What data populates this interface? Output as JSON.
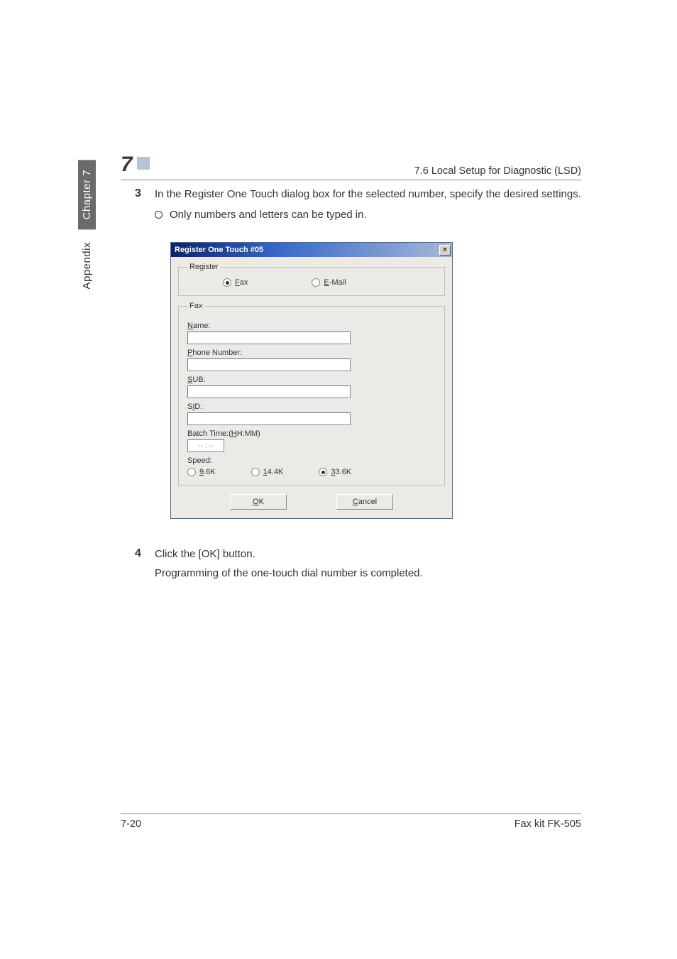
{
  "sidebar": {
    "chapter": "Chapter 7",
    "appendix": "Appendix"
  },
  "header": {
    "page_indicator": "7",
    "section_title": "7.6 Local Setup for Diagnostic (LSD)"
  },
  "steps": {
    "s3": {
      "num": "3",
      "text": "In the Register One Touch dialog box for the selected number, specify the desired settings.",
      "bullet": "Only numbers and letters can be typed in."
    },
    "s4": {
      "num": "4",
      "text": "Click the [OK] button.",
      "after": "Programming of the one-touch dial number is completed."
    }
  },
  "dialog": {
    "title": "Register One Touch #05",
    "close_glyph": "×",
    "register_legend": "Register",
    "radio_fax": "Fax",
    "radio_email": "E-Mail",
    "fax_legend": "Fax",
    "name_label": "Name:",
    "phone_label": "Phone Number:",
    "sub_label": "SUB:",
    "sid_label": "SID:",
    "batch_label": "Batch Time:(HH:MM)",
    "batch_value": "-- : --",
    "speed_label": "Speed:",
    "speed_96": "9.6K",
    "speed_144": "14.4K",
    "speed_336": "33.6K",
    "ok": "OK",
    "cancel": "Cancel"
  },
  "footer": {
    "left": "7-20",
    "right": "Fax kit FK-505"
  }
}
